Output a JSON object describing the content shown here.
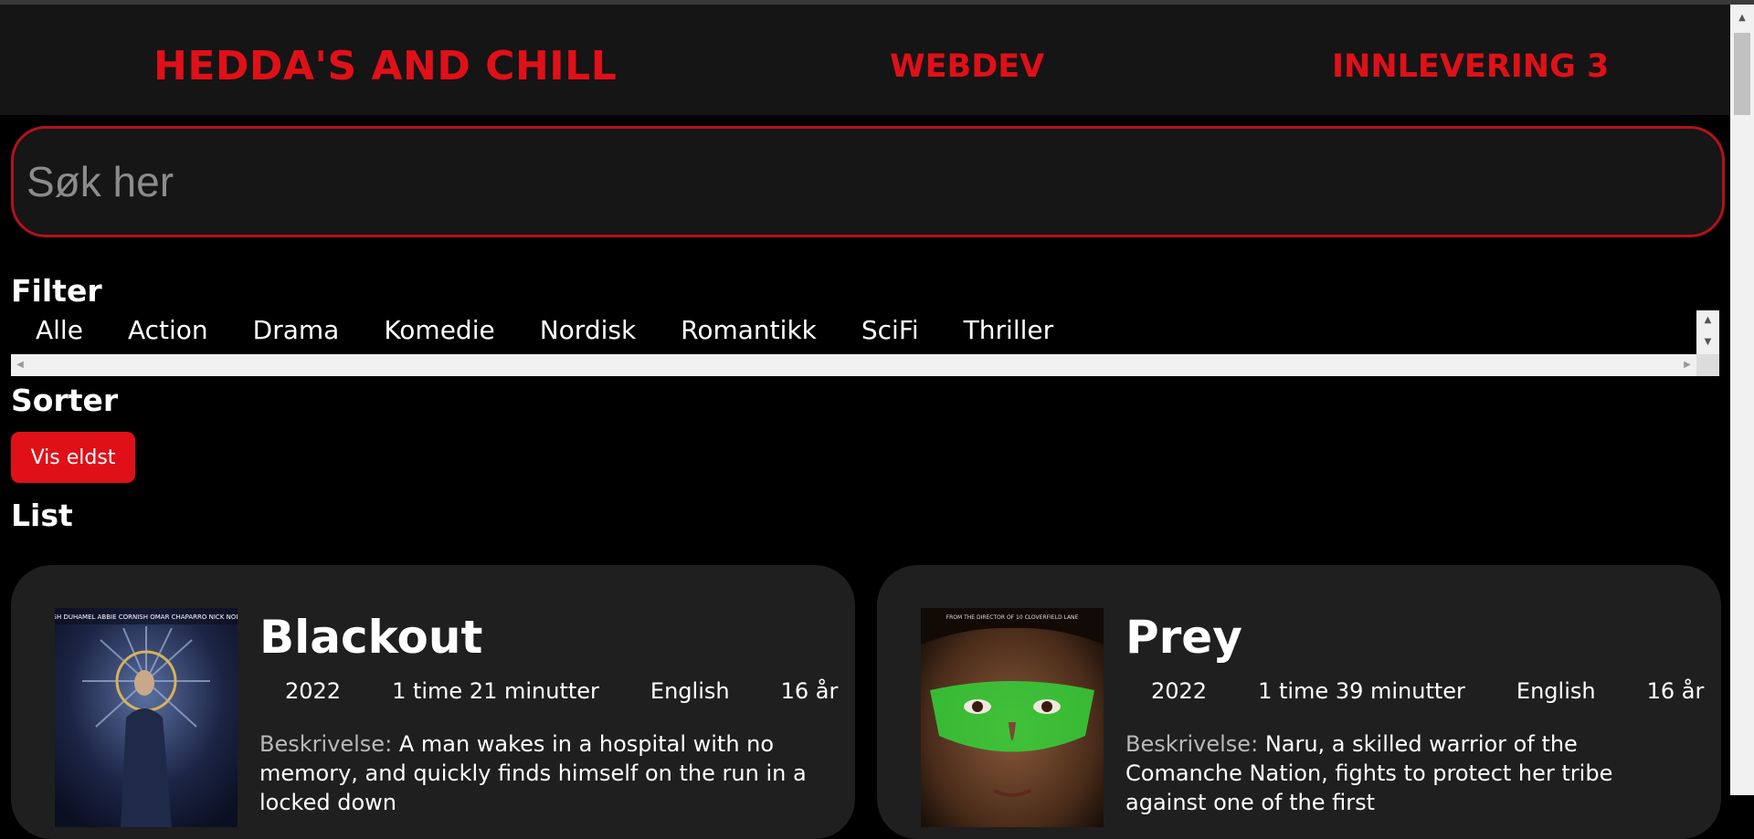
{
  "header": {
    "brand": "HEDDA'S AND CHILL",
    "nav_webdev": "WEBDEV",
    "nav_innlevering": "INNLEVERING 3"
  },
  "search": {
    "placeholder": "Søk her",
    "value": ""
  },
  "filter": {
    "heading": "Filter",
    "items": [
      "Alle",
      "Action",
      "Drama",
      "Komedie",
      "Nordisk",
      "Romantikk",
      "SciFi",
      "Thriller"
    ]
  },
  "sorter": {
    "heading": "Sorter",
    "button_label": "Vis eldst"
  },
  "list": {
    "heading": "List",
    "movies": [
      {
        "title": "Blackout",
        "year": "2022",
        "duration": "1 time 21 minutter",
        "language": "English",
        "age": "16 år",
        "desc_label": "Beskrivelse:",
        "description": "A man wakes in a hospital with no memory, and quickly finds himself on the run in a locked down",
        "poster_credits": "JOSH DUHAMEL   ABBIE CORNISH   OMAR CHAPARRO   NICK NOLTE"
      },
      {
        "title": "Prey",
        "year": "2022",
        "duration": "1 time 39 minutter",
        "language": "English",
        "age": "16 år",
        "desc_label": "Beskrivelse:",
        "description": "Naru, a skilled warrior of the Comanche Nation, fights to protect her tribe against one of the first",
        "poster_credits": "FROM THE DIRECTOR OF 10 CLOVERFIELD LANE"
      }
    ]
  },
  "colors": {
    "accent": "#e01018",
    "card_bg": "#1f1f1f",
    "header_bg": "#151515"
  }
}
